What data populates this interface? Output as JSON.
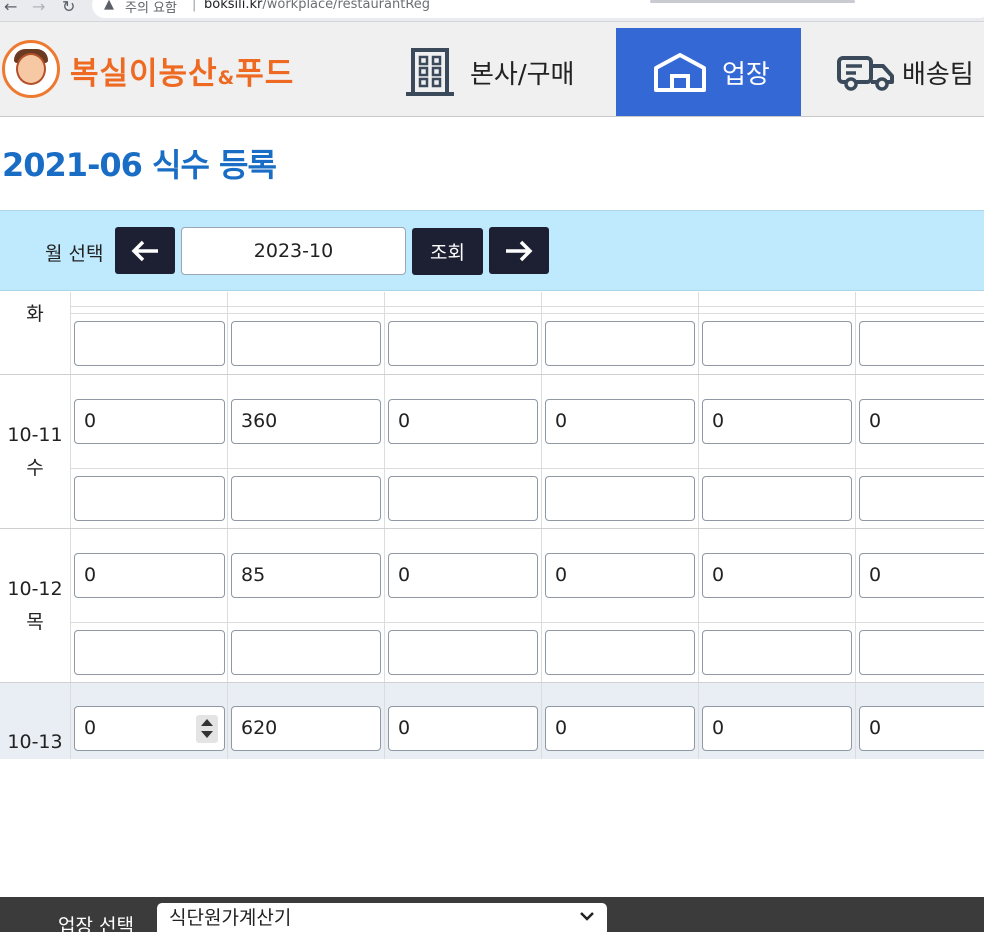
{
  "browser": {
    "security_text": "주의 요함",
    "url_host": "boksili.kr",
    "url_path": "/workplace/restaurantReg"
  },
  "header": {
    "brand_main": "복실이농산",
    "brand_amp": "&",
    "brand_tail": "푸드",
    "nav": [
      {
        "label": "본사/구매",
        "icon": "building-icon",
        "active": false
      },
      {
        "label": "업장",
        "icon": "store-icon",
        "active": true
      },
      {
        "label": "배송팀",
        "icon": "truck-icon",
        "active": false
      }
    ]
  },
  "page": {
    "title": "2021-06 식수 등록"
  },
  "month_selector": {
    "label": "월 선택",
    "value": "2023-10",
    "search_label": "조회"
  },
  "rows": [
    {
      "date": "",
      "day": "화",
      "values": [
        "",
        "",
        "",
        "",
        "",
        ""
      ],
      "values2": null
    },
    {
      "date": "10-11",
      "day": "수",
      "values": [
        "0",
        "360",
        "0",
        "0",
        "0",
        "0"
      ],
      "values2": [
        "",
        "",
        "",
        "",
        "",
        ""
      ]
    },
    {
      "date": "10-12",
      "day": "목",
      "values": [
        "0",
        "85",
        "0",
        "0",
        "0",
        "0"
      ],
      "values2": [
        "",
        "",
        "",
        "",
        "",
        ""
      ]
    },
    {
      "date": "10-13",
      "day": "",
      "values": [
        "0",
        "620",
        "0",
        "0",
        "0",
        "0"
      ],
      "values2": null
    }
  ],
  "bottom": {
    "label": "업장 선택",
    "selected": "식단원가계산기"
  },
  "colors": {
    "brand_orange": "#ee6a23",
    "nav_active": "#3469d5",
    "title_blue": "#1a6dc4",
    "month_bar": "#bfeafd",
    "dark_button": "#1d2033"
  }
}
